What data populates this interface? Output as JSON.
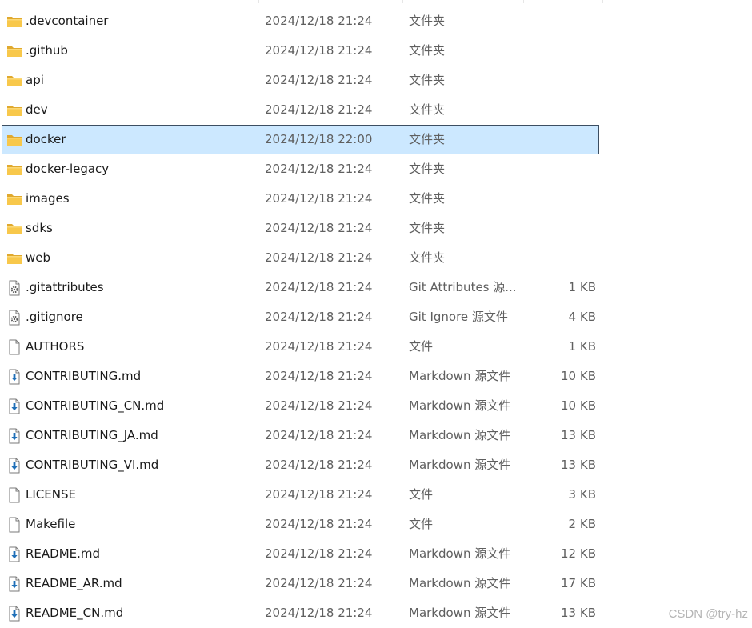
{
  "rows": [
    {
      "name": ".devcontainer",
      "date": "2024/12/18 21:24",
      "type": "文件夹",
      "size": "",
      "icon": "folder-icon",
      "selected": false
    },
    {
      "name": ".github",
      "date": "2024/12/18 21:24",
      "type": "文件夹",
      "size": "",
      "icon": "folder-icon",
      "selected": false
    },
    {
      "name": "api",
      "date": "2024/12/18 21:24",
      "type": "文件夹",
      "size": "",
      "icon": "folder-icon",
      "selected": false
    },
    {
      "name": "dev",
      "date": "2024/12/18 21:24",
      "type": "文件夹",
      "size": "",
      "icon": "folder-icon",
      "selected": false
    },
    {
      "name": "docker",
      "date": "2024/12/18 22:00",
      "type": "文件夹",
      "size": "",
      "icon": "folder-icon",
      "selected": true
    },
    {
      "name": "docker-legacy",
      "date": "2024/12/18 21:24",
      "type": "文件夹",
      "size": "",
      "icon": "folder-icon",
      "selected": false
    },
    {
      "name": "images",
      "date": "2024/12/18 21:24",
      "type": "文件夹",
      "size": "",
      "icon": "folder-icon",
      "selected": false
    },
    {
      "name": "sdks",
      "date": "2024/12/18 21:24",
      "type": "文件夹",
      "size": "",
      "icon": "folder-icon",
      "selected": false
    },
    {
      "name": "web",
      "date": "2024/12/18 21:24",
      "type": "文件夹",
      "size": "",
      "icon": "folder-icon",
      "selected": false
    },
    {
      "name": ".gitattributes",
      "date": "2024/12/18 21:24",
      "type": "Git Attributes 源...",
      "size": "1 KB",
      "icon": "config-file-icon",
      "selected": false
    },
    {
      "name": ".gitignore",
      "date": "2024/12/18 21:24",
      "type": "Git Ignore 源文件",
      "size": "4 KB",
      "icon": "config-file-icon",
      "selected": false
    },
    {
      "name": "AUTHORS",
      "date": "2024/12/18 21:24",
      "type": "文件",
      "size": "1 KB",
      "icon": "blank-file-icon",
      "selected": false
    },
    {
      "name": "CONTRIBUTING.md",
      "date": "2024/12/18 21:24",
      "type": "Markdown 源文件",
      "size": "10 KB",
      "icon": "markdown-file-icon",
      "selected": false
    },
    {
      "name": "CONTRIBUTING_CN.md",
      "date": "2024/12/18 21:24",
      "type": "Markdown 源文件",
      "size": "10 KB",
      "icon": "markdown-file-icon",
      "selected": false
    },
    {
      "name": "CONTRIBUTING_JA.md",
      "date": "2024/12/18 21:24",
      "type": "Markdown 源文件",
      "size": "13 KB",
      "icon": "markdown-file-icon",
      "selected": false
    },
    {
      "name": "CONTRIBUTING_VI.md",
      "date": "2024/12/18 21:24",
      "type": "Markdown 源文件",
      "size": "13 KB",
      "icon": "markdown-file-icon",
      "selected": false
    },
    {
      "name": "LICENSE",
      "date": "2024/12/18 21:24",
      "type": "文件",
      "size": "3 KB",
      "icon": "blank-file-icon",
      "selected": false
    },
    {
      "name": "Makefile",
      "date": "2024/12/18 21:24",
      "type": "文件",
      "size": "2 KB",
      "icon": "blank-file-icon",
      "selected": false
    },
    {
      "name": "README.md",
      "date": "2024/12/18 21:24",
      "type": "Markdown 源文件",
      "size": "12 KB",
      "icon": "markdown-file-icon",
      "selected": false
    },
    {
      "name": "README_AR.md",
      "date": "2024/12/18 21:24",
      "type": "Markdown 源文件",
      "size": "17 KB",
      "icon": "markdown-file-icon",
      "selected": false
    },
    {
      "name": "README_CN.md",
      "date": "2024/12/18 21:24",
      "type": "Markdown 源文件",
      "size": "13 KB",
      "icon": "markdown-file-icon",
      "selected": false
    }
  ],
  "watermark": "CSDN @try-hz",
  "colors": {
    "selection_bg": "#cce8ff",
    "selection_border": "#3c4e62",
    "folder_yellow": "#f8c84b",
    "markdown_arrow": "#1f6fb8"
  }
}
